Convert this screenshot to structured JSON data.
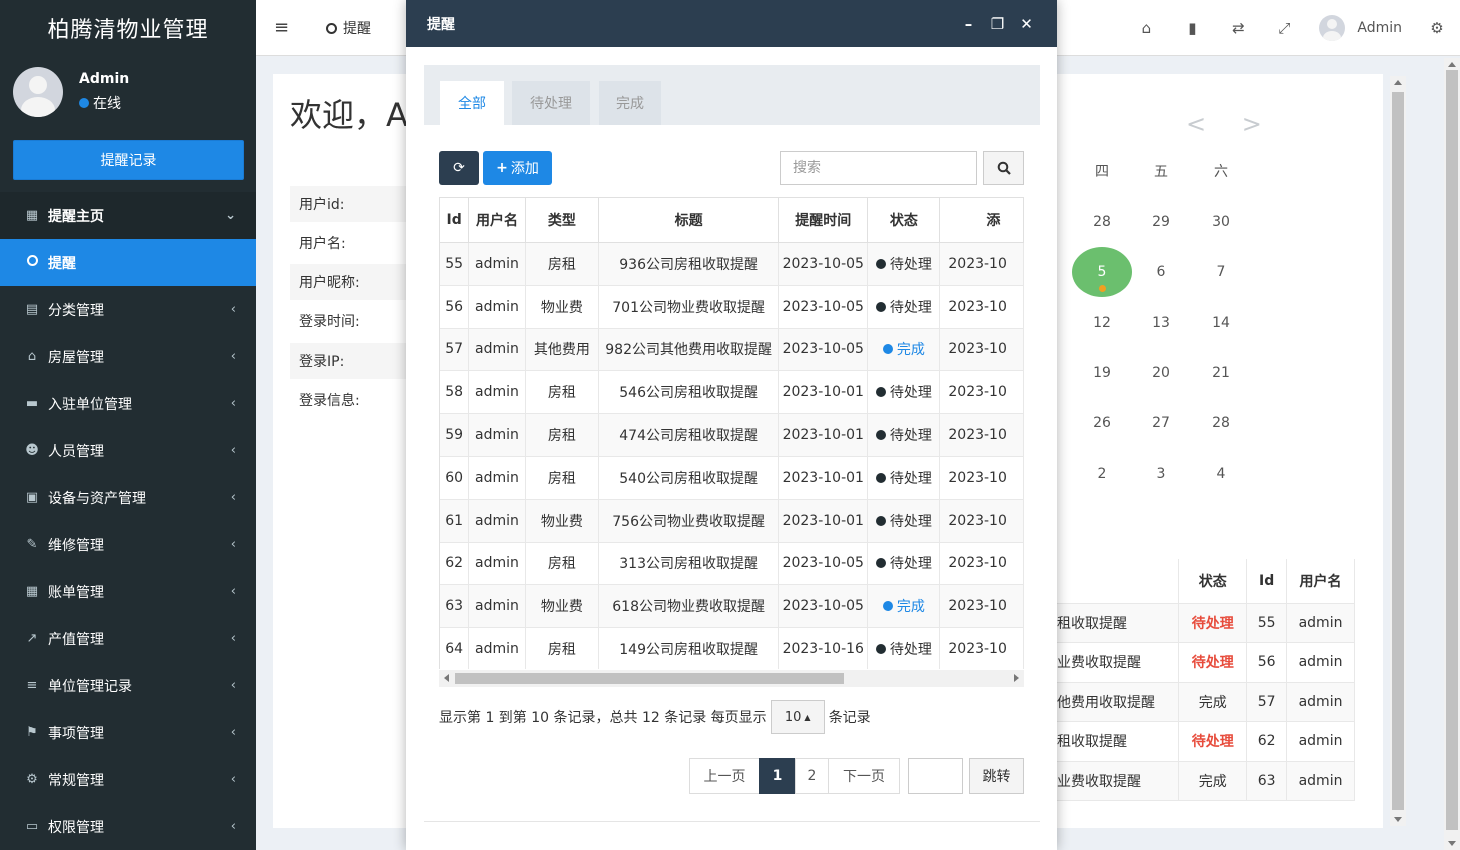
{
  "brand": "柏腾清物业管理",
  "user": {
    "name": "Admin",
    "status": "在线"
  },
  "sidebar": {
    "remind_button": "提醒记录",
    "items": [
      {
        "label": "提醒主页",
        "icon": "calendar-icon",
        "glyph": "▦",
        "arrow": "⌄"
      },
      {
        "label": "提醒",
        "icon": "circle-icon",
        "glyph": "",
        "arrow": ""
      },
      {
        "label": "分类管理",
        "icon": "book-icon",
        "glyph": "▤",
        "arrow": "‹"
      },
      {
        "label": "房屋管理",
        "icon": "home-icon",
        "glyph": "⌂",
        "arrow": "‹"
      },
      {
        "label": "入驻单位管理",
        "icon": "briefcase-icon",
        "glyph": "▬",
        "arrow": "‹"
      },
      {
        "label": "人员管理",
        "icon": "users-icon",
        "glyph": "☻",
        "arrow": "‹"
      },
      {
        "label": "设备与资产管理",
        "icon": "list-alt-icon",
        "glyph": "▣",
        "arrow": "‹"
      },
      {
        "label": "维修管理",
        "icon": "wrench-icon",
        "glyph": "✎",
        "arrow": "‹"
      },
      {
        "label": "账单管理",
        "icon": "calculator-icon",
        "glyph": "▦",
        "arrow": "‹"
      },
      {
        "label": "产值管理",
        "icon": "line-chart-icon",
        "glyph": "↗",
        "arrow": "‹"
      },
      {
        "label": "单位管理记录",
        "icon": "bars-icon",
        "glyph": "≡",
        "arrow": "‹"
      },
      {
        "label": "事项管理",
        "icon": "flag-icon",
        "glyph": "⚑",
        "arrow": "‹"
      },
      {
        "label": "常规管理",
        "icon": "cogs-icon",
        "glyph": "⚙",
        "arrow": "‹"
      },
      {
        "label": "权限管理",
        "icon": "desktop-icon",
        "glyph": "▭",
        "arrow": "‹"
      }
    ]
  },
  "topbar": {
    "menu_toggle": "≡",
    "tab_label": "提醒",
    "admin_name": "Admin"
  },
  "welcome": {
    "title": "欢迎，Ad"
  },
  "info_labels": [
    "用户id:",
    "用户名:",
    "用户昵称:",
    "登录时间:",
    "登录IP:",
    "登录信息:"
  ],
  "calendar": {
    "nav": "< >",
    "weekdays": [
      "四",
      "五",
      "六"
    ],
    "weeks": [
      [
        "28",
        "29",
        "30"
      ],
      [
        "5",
        "6",
        "7"
      ],
      [
        "12",
        "13",
        "14"
      ],
      [
        "19",
        "20",
        "21"
      ],
      [
        "26",
        "27",
        "28"
      ],
      [
        "2",
        "3",
        "4"
      ]
    ]
  },
  "right_table": {
    "headers": [
      "状态",
      "Id",
      "用户名"
    ],
    "rows": [
      {
        "title": "租收取提醒",
        "status": "待处理",
        "pending": true,
        "id": "55",
        "user": "admin"
      },
      {
        "title": "业费收取提醒",
        "status": "待处理",
        "pending": true,
        "id": "56",
        "user": "admin"
      },
      {
        "title": "他费用收取提醒",
        "status": "完成",
        "pending": false,
        "id": "57",
        "user": "admin"
      },
      {
        "title": "租收取提醒",
        "status": "待处理",
        "pending": true,
        "id": "62",
        "user": "admin"
      },
      {
        "title": "业费收取提醒",
        "status": "完成",
        "pending": false,
        "id": "63",
        "user": "admin"
      }
    ]
  },
  "modal": {
    "title": "提醒",
    "tabs": [
      "全部",
      "待处理",
      "完成"
    ],
    "add_label": "添加",
    "search_placeholder": "搜索",
    "headers": [
      "Id",
      "用户名",
      "类型",
      "标题",
      "提醒时间",
      "状态",
      "添"
    ],
    "rows": [
      {
        "id": "55",
        "user": "admin",
        "type": "房租",
        "title": "936公司房租收取提醒",
        "time": "2023-10-05",
        "status": "待处理",
        "done": false,
        "extra": "2023-10"
      },
      {
        "id": "56",
        "user": "admin",
        "type": "物业费",
        "title": "701公司物业费收取提醒",
        "time": "2023-10-05",
        "status": "待处理",
        "done": false,
        "extra": "2023-10"
      },
      {
        "id": "57",
        "user": "admin",
        "type": "其他费用",
        "title": "982公司其他费用收取提醒",
        "time": "2023-10-05",
        "status": "完成",
        "done": true,
        "extra": "2023-10"
      },
      {
        "id": "58",
        "user": "admin",
        "type": "房租",
        "title": "546公司房租收取提醒",
        "time": "2023-10-01",
        "status": "待处理",
        "done": false,
        "extra": "2023-10"
      },
      {
        "id": "59",
        "user": "admin",
        "type": "房租",
        "title": "474公司房租收取提醒",
        "time": "2023-10-01",
        "status": "待处理",
        "done": false,
        "extra": "2023-10"
      },
      {
        "id": "60",
        "user": "admin",
        "type": "房租",
        "title": "540公司房租收取提醒",
        "time": "2023-10-01",
        "status": "待处理",
        "done": false,
        "extra": "2023-10"
      },
      {
        "id": "61",
        "user": "admin",
        "type": "物业费",
        "title": "756公司物业费收取提醒",
        "time": "2023-10-01",
        "status": "待处理",
        "done": false,
        "extra": "2023-10"
      },
      {
        "id": "62",
        "user": "admin",
        "type": "房租",
        "title": "313公司房租收取提醒",
        "time": "2023-10-05",
        "status": "待处理",
        "done": false,
        "extra": "2023-10"
      },
      {
        "id": "63",
        "user": "admin",
        "type": "物业费",
        "title": "618公司物业费收取提醒",
        "time": "2023-10-05",
        "status": "完成",
        "done": true,
        "extra": "2023-10"
      },
      {
        "id": "64",
        "user": "admin",
        "type": "房租",
        "title": "149公司房租收取提醒",
        "time": "2023-10-16",
        "status": "待处理",
        "done": false,
        "extra": "2023-10"
      }
    ],
    "pagination": {
      "summary": "显示第 1 到第 10 条记录，总共 12 条记录 每页显示",
      "page_size": "10",
      "suffix": "条记录",
      "prev": "上一页",
      "pages": [
        "1",
        "2"
      ],
      "next": "下一页",
      "jump": "跳转"
    }
  },
  "colors": {
    "sidebar": "#222d32",
    "accent": "#1e88e5",
    "modal_header": "#2c3e50",
    "pending": "#e74c3c",
    "today": "#6bbf6e"
  }
}
